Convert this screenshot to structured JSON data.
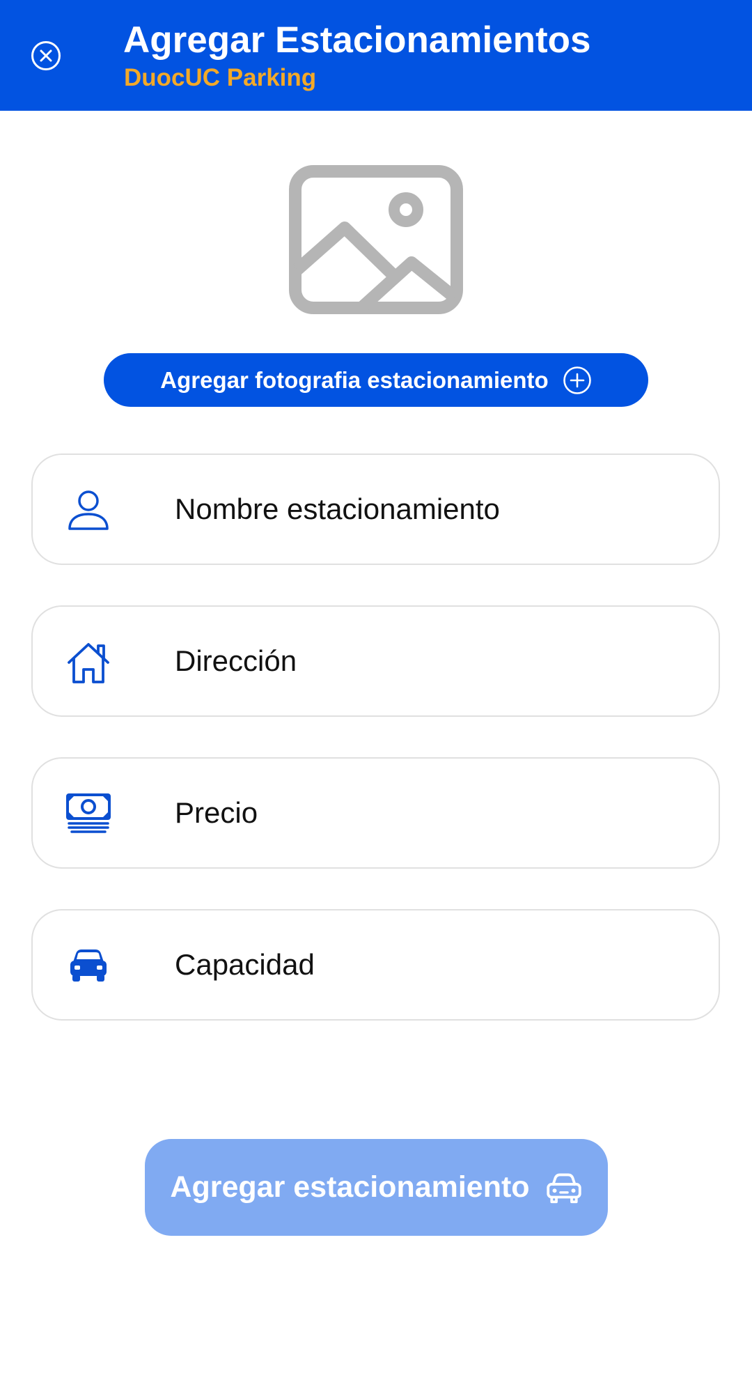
{
  "header": {
    "title": "Agregar Estacionamientos",
    "subtitle": "DuocUC Parking",
    "close_icon": "close-circle-icon"
  },
  "photo": {
    "placeholder_icon": "image-placeholder-icon",
    "add_button_label": "Agregar fotografia estacionamiento",
    "add_button_icon": "plus-circle-icon"
  },
  "form": {
    "fields": [
      {
        "icon": "person-icon",
        "placeholder": "Nombre estacionamiento"
      },
      {
        "icon": "home-icon",
        "placeholder": "Dirección"
      },
      {
        "icon": "money-icon",
        "placeholder": "Precio"
      },
      {
        "icon": "car-icon",
        "placeholder": "Capacidad"
      }
    ]
  },
  "submit": {
    "label": "Agregar estacionamiento",
    "icon": "car-icon"
  },
  "colors": {
    "primary": "#0253e1",
    "accent": "#f3a928",
    "icon_blue": "#0b4fd0",
    "disabled_button": "#80aaf2",
    "placeholder_gray": "#b5b5b5",
    "field_border": "#e0e0e0"
  }
}
